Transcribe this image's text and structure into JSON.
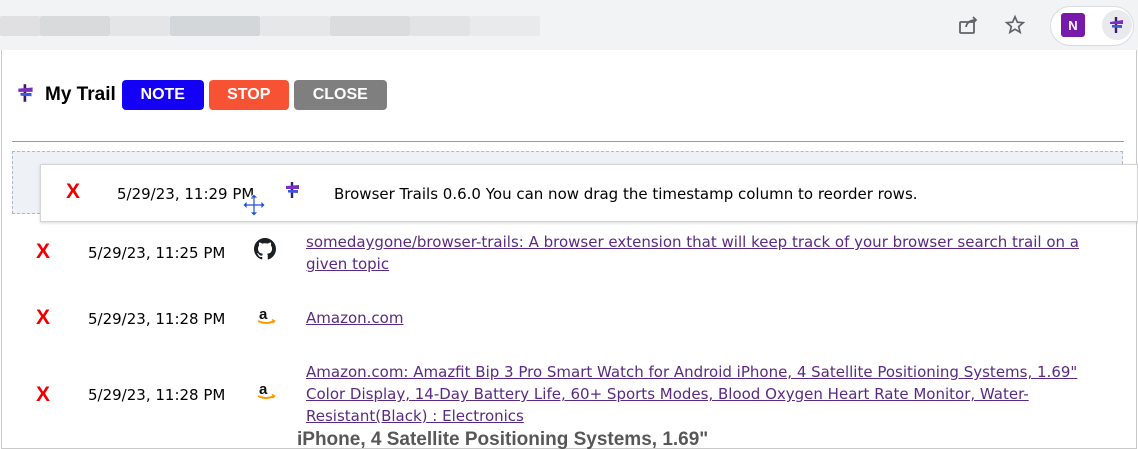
{
  "toolbar": {
    "share_icon": "share-icon",
    "bookmark_icon": "star-icon",
    "onenote_label": "N",
    "extension_icon": "trail-icon"
  },
  "popup": {
    "title": "My Trail",
    "buttons": {
      "note": "NOTE",
      "stop": "STOP",
      "close": "CLOSE"
    },
    "button_colors": {
      "note": "#1400f5",
      "stop": "#f75233",
      "close": "#7f7f7f"
    }
  },
  "rows": [
    {
      "delete": "X",
      "timestamp": "5/29/23, 11:29 PM",
      "icon": "trail-icon",
      "text": "Browser Trails 0.6.0 You can now drag the timestamp column to reorder rows.",
      "is_link": false
    },
    {
      "delete": "X",
      "timestamp": "5/29/23, 11:25 PM",
      "icon": "github-icon",
      "text": "somedaygone/browser-trails: A browser extension that will keep track of your browser search trail on a given topic",
      "is_link": true
    },
    {
      "delete": "X",
      "timestamp": "5/29/23, 11:28 PM",
      "icon": "amazon-icon",
      "text": "Amazon.com",
      "is_link": true
    },
    {
      "delete": "X",
      "timestamp": "5/29/23, 11:28 PM",
      "icon": "amazon-icon",
      "text": "Amazon.com: Amazfit Bip 3 Pro Smart Watch for Android iPhone, 4 Satellite Positioning Systems, 1.69\" Color Display, 14-Day Battery Life, 60+ Sports Modes, Blood Oxygen Heart Rate Monitor, Water-Resistant(Black) : Electronics",
      "is_link": true
    }
  ],
  "background_page_text": "iPhone, 4 Satellite Positioning Systems, 1.69\"",
  "colors": {
    "delete": "#ee0000",
    "link": "#5a2a82",
    "trail_purple": "#7a2fc0"
  }
}
